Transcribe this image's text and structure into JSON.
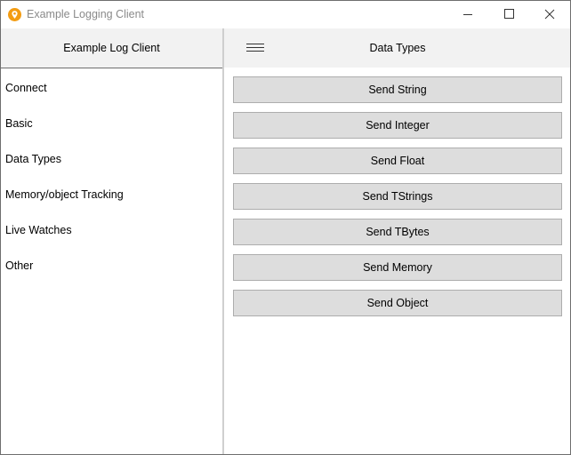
{
  "window": {
    "title": "Example Logging Client",
    "app_icon": "orange-pin-icon",
    "controls": {
      "minimize_icon": "minimize-icon",
      "maximize_icon": "maximize-icon",
      "close_icon": "close-icon"
    }
  },
  "sidebar": {
    "title": "Example Log Client",
    "items": [
      {
        "label": "Connect"
      },
      {
        "label": "Basic"
      },
      {
        "label": "Data Types"
      },
      {
        "label": "Memory/object Tracking"
      },
      {
        "label": "Live Watches"
      },
      {
        "label": "Other"
      }
    ]
  },
  "main": {
    "menu_icon": "hamburger-menu-icon",
    "title": "Data Types",
    "buttons": [
      {
        "label": "Send String"
      },
      {
        "label": "Send Integer"
      },
      {
        "label": "Send Float"
      },
      {
        "label": "Send TStrings"
      },
      {
        "label": "Send TBytes"
      },
      {
        "label": "Send Memory"
      },
      {
        "label": "Send Object"
      }
    ]
  },
  "colors": {
    "accent_icon": "#f39c12",
    "header_background": "#f2f2f2",
    "button_background": "#dddddd",
    "button_border": "#adadad",
    "title_text": "#8a8a8a"
  }
}
